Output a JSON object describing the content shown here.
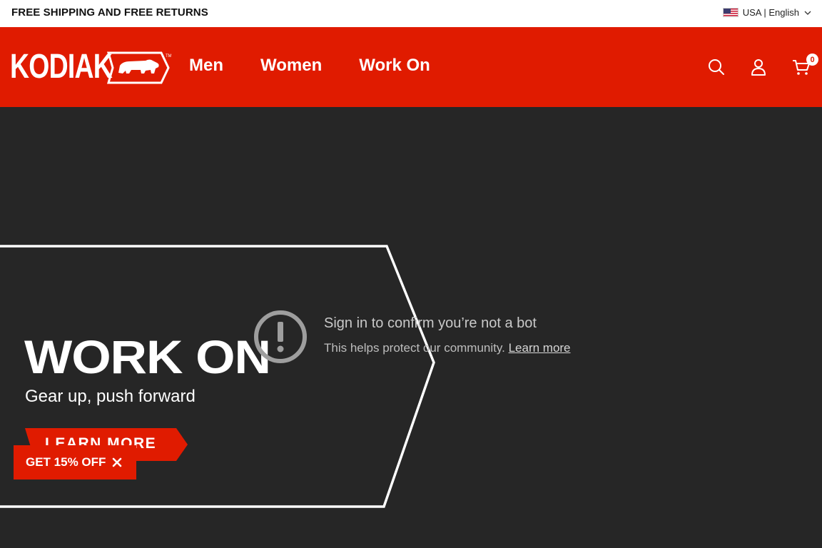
{
  "topbar": {
    "announcement": "FREE SHIPPING AND FREE RETURNS",
    "locale": "USA | English",
    "flag_icon": "us-flag-icon"
  },
  "header": {
    "logo_text": "KODIAK",
    "nav": [
      "Men",
      "Women",
      "Work On"
    ],
    "cart_count": "0",
    "icons": [
      "search-icon",
      "account-icon",
      "cart-icon"
    ]
  },
  "hero": {
    "title": "WORK ON",
    "subtitle": "Gear up, push forward",
    "cta_label": "LEARN MORE"
  },
  "bot_check": {
    "title": "Sign in to confirm you’re not a bot",
    "message": "This helps protect our community.",
    "link_label": "Learn more"
  },
  "discount": {
    "label": "GET 15% OFF"
  },
  "colors": {
    "brand_red": "#e01b00",
    "hero_bg": "#262626",
    "white": "#ffffff"
  }
}
